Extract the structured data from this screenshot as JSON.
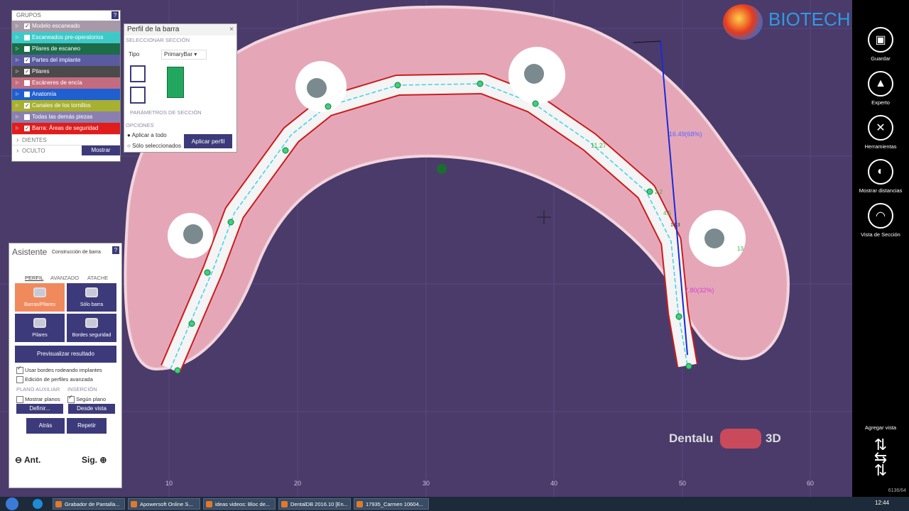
{
  "groups": {
    "header": "GRUPOS",
    "help": "?",
    "items": [
      {
        "label": "Modelo escaneado",
        "checked": true,
        "color": "#a79aa8"
      },
      {
        "label": "Escaneados pre-operatorios",
        "checked": false,
        "color": "#3ec9c9"
      },
      {
        "label": "Pilares de escaneo",
        "checked": false,
        "color": "#1c6b49"
      },
      {
        "label": "Partes del implante",
        "checked": true,
        "color": "#5a5aa0"
      },
      {
        "label": "Pilares",
        "checked": true,
        "color": "#4a4a4a"
      },
      {
        "label": "Escáneres de encía",
        "checked": false,
        "color": "#c36c7f"
      },
      {
        "label": "Anatomía",
        "checked": false,
        "color": "#1f5fcf"
      },
      {
        "label": "Canales de los tornillos",
        "checked": true,
        "color": "#a8b030"
      },
      {
        "label": "Todas las demás piezas",
        "checked": false,
        "color": "#8a80b0"
      },
      {
        "label": "Barra: Áreas de seguridad",
        "checked": true,
        "color": "#e01c1c"
      }
    ],
    "dientes": "DIENTES",
    "oculto": "OCULTO",
    "mostrar": "Mostrar"
  },
  "profile": {
    "title": "Perfil de la barra",
    "close": "×",
    "section": "SELECCIONAR SECCIÓN",
    "tipo_label": "Tipo",
    "tipo_value": "PrimaryBar",
    "params": "PARÁMETROS DE SECCIÓN",
    "opciones": "OPCIONES",
    "opt1": "Aplicar a todo",
    "opt2": "Sólo seleccionados",
    "apply": "Aplicar perfil",
    "bar_color": "#22a85e"
  },
  "wizard": {
    "title": "Asistente",
    "subtitle": "Construcción de barra",
    "help": "?",
    "tabs": [
      "PERFIL",
      "AVANZADO",
      "ATACHE"
    ],
    "btns": [
      "Barras/Pilares",
      "Sólo barra",
      "Pilares",
      "Bordes seguridad"
    ],
    "preview": "Previsualizar resultado",
    "chk1": "Usar bordes rodeando implantes",
    "chk2": "Edición de perfiles avanzada",
    "plano": "PLANO AUXILIAR",
    "insercion": "INSERCIÓN",
    "chk3": "Mostrar planos",
    "chk4": "Según plano",
    "definir": "Definir...",
    "desde": "Desde vista",
    "atras": "Atrás",
    "repetir": "Repetir",
    "ant": "Ant.",
    "sig": "Sig."
  },
  "right": {
    "guardar": "Guardar",
    "experto": "Experto",
    "herramientas": "Herramientas",
    "mostrar_dist": "Mostrar distancias",
    "vista_seccion": "Vista de Sección",
    "agregar": "Agregar vista",
    "counter": "6136/64"
  },
  "brand": {
    "biotech": "BIOTECH",
    "dentalu": "Dentalu",
    "d3": "3D"
  },
  "measure": {
    "m1": "16.49(68%)",
    "m2": "11.27",
    "m3": "7.80(32%)",
    "m4": "4.5",
    "m5": "2.2",
    "m6": "14.3",
    "m7": "13"
  },
  "ticks": [
    "10",
    "20",
    "30",
    "40",
    "50",
    "60"
  ],
  "taskbar": {
    "items": [
      "Grabador de Pantalla...",
      "Apowersoft Online S...",
      "ideas videos: Bloc de...",
      "DentalDB 2016.10 [En...",
      "17935_Carmen 10604..."
    ],
    "clock": "12:44"
  }
}
